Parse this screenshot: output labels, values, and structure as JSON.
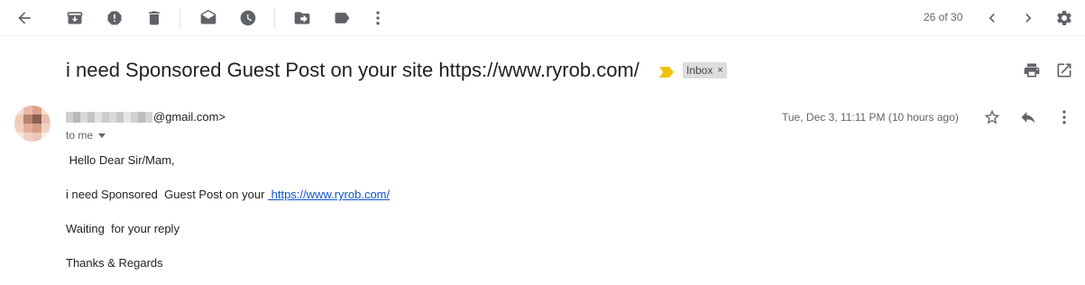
{
  "toolbar": {
    "pager": "26 of 30",
    "icons": [
      "back-arrow-icon",
      "archive-icon",
      "report-spam-icon",
      "delete-icon",
      "mark-unread-icon",
      "snooze-icon",
      "move-to-icon",
      "labels-icon",
      "more-vert-icon",
      "chevron-left-icon",
      "chevron-right-icon",
      "settings-gear-icon"
    ]
  },
  "message": {
    "subject": "i need Sponsored Guest Post on your site https://www.ryrob.com/",
    "label": "Inbox",
    "label_remove": "×",
    "sender_email_suffix": "@gmail.com>",
    "recipient": "to me",
    "date": "Tue, Dec 3, 11:11 PM (10 hours ago)",
    "body": {
      "greeting": " Hello Dear Sir/Mam,",
      "line1_prefix": "i need Sponsored  Guest Post on your ",
      "line1_link": " https://www.ryrob.com/",
      "line2": "Waiting  for your reply",
      "line3": "Thanks & Regards"
    }
  },
  "colors": {
    "icon_gray": "#5f6368",
    "link_blue": "#1155cc",
    "importance_yellow": "#f4c20d",
    "label_bg": "#dddddd"
  }
}
